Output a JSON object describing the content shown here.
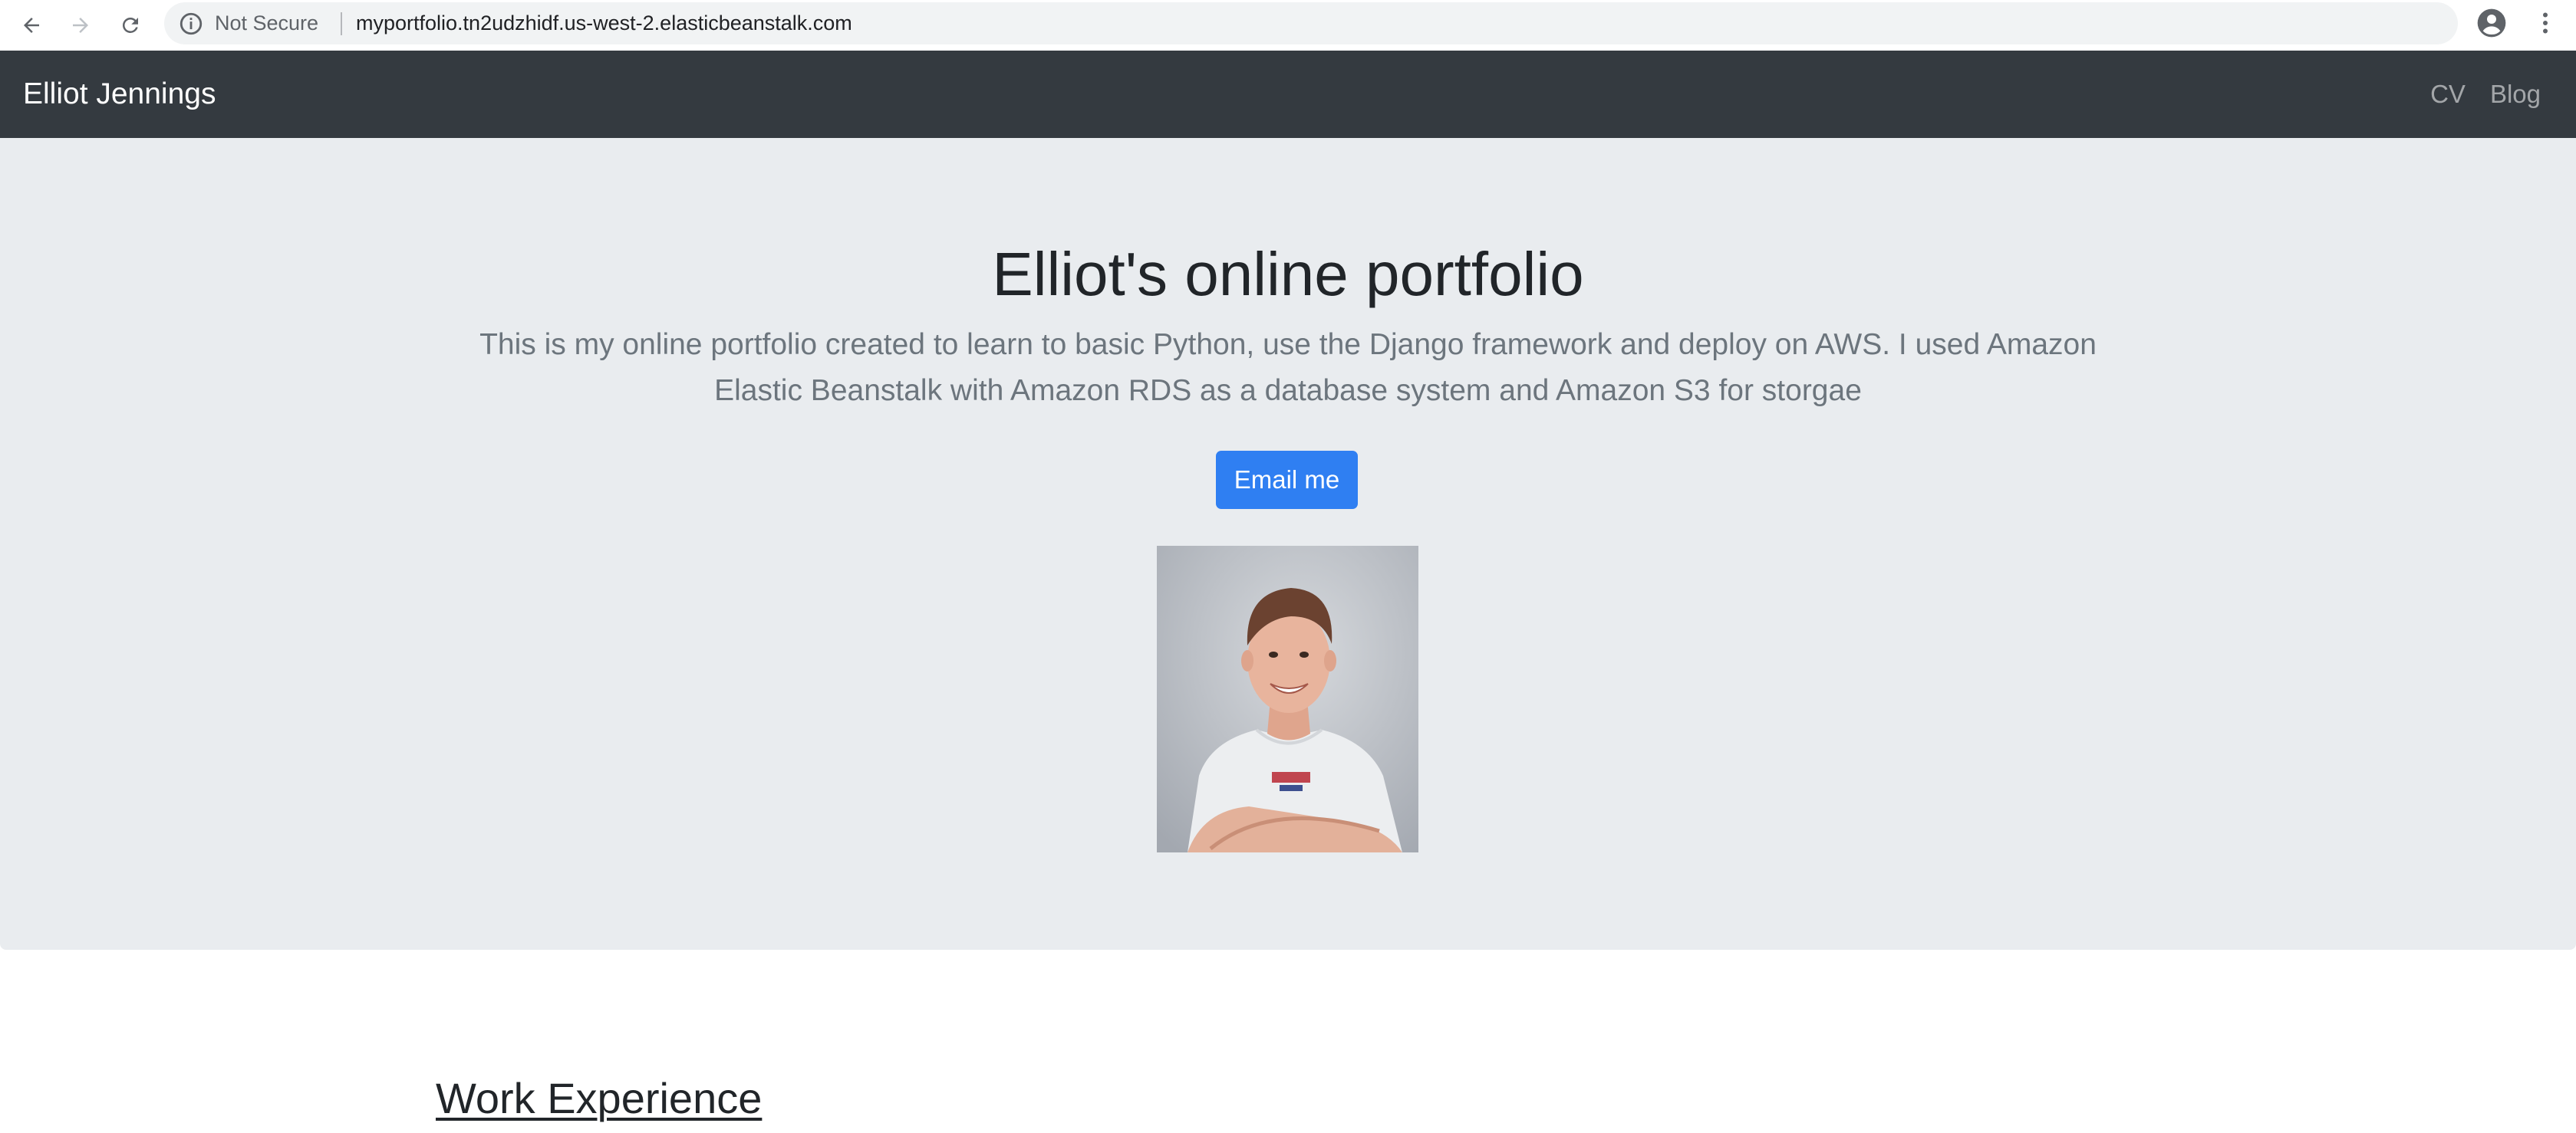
{
  "browser": {
    "security_label": "Not Secure",
    "url": "myportfolio.tn2udzhidf.us-west-2.elasticbeanstalk.com",
    "icons": [
      "back-icon",
      "forward-icon",
      "reload-icon",
      "info-icon",
      "star-icon",
      "account-icon",
      "menu-icon"
    ]
  },
  "navbar": {
    "brand": "Elliot Jennings",
    "links": [
      {
        "label": "CV"
      },
      {
        "label": "Blog"
      }
    ],
    "background": "#343a40"
  },
  "hero": {
    "title": "Elliot's online portfolio",
    "lead": "This is my online portfolio created to learn to basic Python, use the Django framework and deploy on AWS. I used Amazon Elastic Beanstalk with Amazon RDS as a database system and Amazon S3 for storgae",
    "button_label": "Email me",
    "button_color": "#2f7ff2",
    "background": "#e9ecef"
  },
  "content": {
    "section_heading": "Work Experience"
  }
}
